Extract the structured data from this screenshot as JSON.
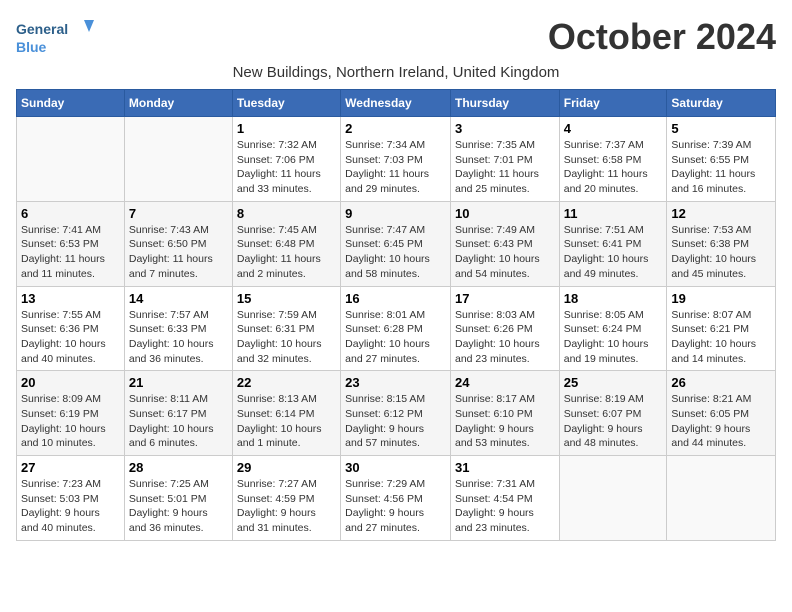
{
  "header": {
    "logo_general": "General",
    "logo_blue": "Blue",
    "month_title": "October 2024",
    "subtitle": "New Buildings, Northern Ireland, United Kingdom"
  },
  "weekdays": [
    "Sunday",
    "Monday",
    "Tuesday",
    "Wednesday",
    "Thursday",
    "Friday",
    "Saturday"
  ],
  "weeks": [
    [
      {
        "day": "",
        "detail": ""
      },
      {
        "day": "",
        "detail": ""
      },
      {
        "day": "1",
        "detail": "Sunrise: 7:32 AM\nSunset: 7:06 PM\nDaylight: 11 hours\nand 33 minutes."
      },
      {
        "day": "2",
        "detail": "Sunrise: 7:34 AM\nSunset: 7:03 PM\nDaylight: 11 hours\nand 29 minutes."
      },
      {
        "day": "3",
        "detail": "Sunrise: 7:35 AM\nSunset: 7:01 PM\nDaylight: 11 hours\nand 25 minutes."
      },
      {
        "day": "4",
        "detail": "Sunrise: 7:37 AM\nSunset: 6:58 PM\nDaylight: 11 hours\nand 20 minutes."
      },
      {
        "day": "5",
        "detail": "Sunrise: 7:39 AM\nSunset: 6:55 PM\nDaylight: 11 hours\nand 16 minutes."
      }
    ],
    [
      {
        "day": "6",
        "detail": "Sunrise: 7:41 AM\nSunset: 6:53 PM\nDaylight: 11 hours\nand 11 minutes."
      },
      {
        "day": "7",
        "detail": "Sunrise: 7:43 AM\nSunset: 6:50 PM\nDaylight: 11 hours\nand 7 minutes."
      },
      {
        "day": "8",
        "detail": "Sunrise: 7:45 AM\nSunset: 6:48 PM\nDaylight: 11 hours\nand 2 minutes."
      },
      {
        "day": "9",
        "detail": "Sunrise: 7:47 AM\nSunset: 6:45 PM\nDaylight: 10 hours\nand 58 minutes."
      },
      {
        "day": "10",
        "detail": "Sunrise: 7:49 AM\nSunset: 6:43 PM\nDaylight: 10 hours\nand 54 minutes."
      },
      {
        "day": "11",
        "detail": "Sunrise: 7:51 AM\nSunset: 6:41 PM\nDaylight: 10 hours\nand 49 minutes."
      },
      {
        "day": "12",
        "detail": "Sunrise: 7:53 AM\nSunset: 6:38 PM\nDaylight: 10 hours\nand 45 minutes."
      }
    ],
    [
      {
        "day": "13",
        "detail": "Sunrise: 7:55 AM\nSunset: 6:36 PM\nDaylight: 10 hours\nand 40 minutes."
      },
      {
        "day": "14",
        "detail": "Sunrise: 7:57 AM\nSunset: 6:33 PM\nDaylight: 10 hours\nand 36 minutes."
      },
      {
        "day": "15",
        "detail": "Sunrise: 7:59 AM\nSunset: 6:31 PM\nDaylight: 10 hours\nand 32 minutes."
      },
      {
        "day": "16",
        "detail": "Sunrise: 8:01 AM\nSunset: 6:28 PM\nDaylight: 10 hours\nand 27 minutes."
      },
      {
        "day": "17",
        "detail": "Sunrise: 8:03 AM\nSunset: 6:26 PM\nDaylight: 10 hours\nand 23 minutes."
      },
      {
        "day": "18",
        "detail": "Sunrise: 8:05 AM\nSunset: 6:24 PM\nDaylight: 10 hours\nand 19 minutes."
      },
      {
        "day": "19",
        "detail": "Sunrise: 8:07 AM\nSunset: 6:21 PM\nDaylight: 10 hours\nand 14 minutes."
      }
    ],
    [
      {
        "day": "20",
        "detail": "Sunrise: 8:09 AM\nSunset: 6:19 PM\nDaylight: 10 hours\nand 10 minutes."
      },
      {
        "day": "21",
        "detail": "Sunrise: 8:11 AM\nSunset: 6:17 PM\nDaylight: 10 hours\nand 6 minutes."
      },
      {
        "day": "22",
        "detail": "Sunrise: 8:13 AM\nSunset: 6:14 PM\nDaylight: 10 hours\nand 1 minute."
      },
      {
        "day": "23",
        "detail": "Sunrise: 8:15 AM\nSunset: 6:12 PM\nDaylight: 9 hours\nand 57 minutes."
      },
      {
        "day": "24",
        "detail": "Sunrise: 8:17 AM\nSunset: 6:10 PM\nDaylight: 9 hours\nand 53 minutes."
      },
      {
        "day": "25",
        "detail": "Sunrise: 8:19 AM\nSunset: 6:07 PM\nDaylight: 9 hours\nand 48 minutes."
      },
      {
        "day": "26",
        "detail": "Sunrise: 8:21 AM\nSunset: 6:05 PM\nDaylight: 9 hours\nand 44 minutes."
      }
    ],
    [
      {
        "day": "27",
        "detail": "Sunrise: 7:23 AM\nSunset: 5:03 PM\nDaylight: 9 hours\nand 40 minutes."
      },
      {
        "day": "28",
        "detail": "Sunrise: 7:25 AM\nSunset: 5:01 PM\nDaylight: 9 hours\nand 36 minutes."
      },
      {
        "day": "29",
        "detail": "Sunrise: 7:27 AM\nSunset: 4:59 PM\nDaylight: 9 hours\nand 31 minutes."
      },
      {
        "day": "30",
        "detail": "Sunrise: 7:29 AM\nSunset: 4:56 PM\nDaylight: 9 hours\nand 27 minutes."
      },
      {
        "day": "31",
        "detail": "Sunrise: 7:31 AM\nSunset: 4:54 PM\nDaylight: 9 hours\nand 23 minutes."
      },
      {
        "day": "",
        "detail": ""
      },
      {
        "day": "",
        "detail": ""
      }
    ]
  ]
}
